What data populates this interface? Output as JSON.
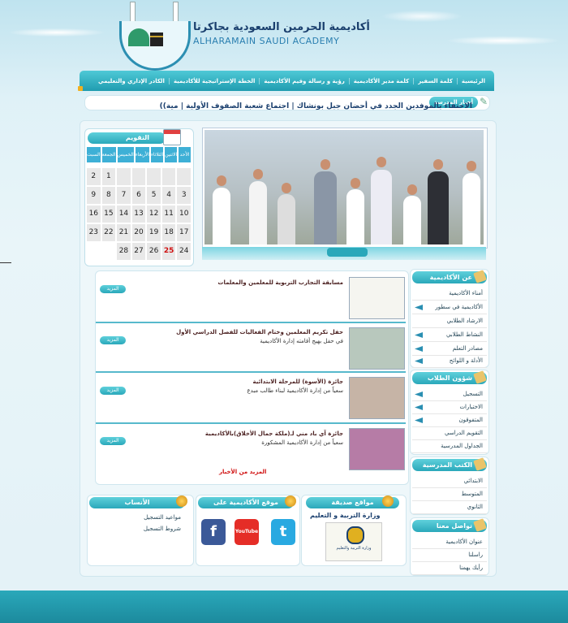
{
  "header": {
    "title_ar": "أكاديمية الحرمين السعودية بجاكرتا",
    "title_en": "ALHARAMAIN SAUDI ACADEMY"
  },
  "nav": [
    "الرئيسية",
    "كلمة السفير",
    "كلمة مدير الأكاديمية",
    "رؤية و رسالة وقيم الأكاديمية",
    "الخطة الإستراتيجية للأكاديمية",
    "الكادر الإداري والتعليمي"
  ],
  "ticker": {
    "label": "أخبار المدرسة",
    "text": "الاحتفاء بالموفدين الجدد في أحضان جبل بونشاك | اجتماع شعبة الصفوف الأولية | مية))"
  },
  "calendar": {
    "title": "التقويم",
    "days": [
      "الأحد",
      "الاثنين",
      "الثلاثاء",
      "الأربعاء",
      "الخميس",
      "الجمعة",
      "السبت"
    ],
    "dates": [
      "",
      "",
      "",
      "",
      "",
      "1",
      "2",
      "3",
      "4",
      "5",
      "6",
      "7",
      "8",
      "9",
      "10",
      "11",
      "12",
      "13",
      "14",
      "15",
      "16",
      "17",
      "18",
      "19",
      "20",
      "21",
      "22",
      "23",
      "24",
      "25",
      "26",
      "27",
      "28"
    ],
    "highlight": "25",
    "highlight_color": "#d01010"
  },
  "news": {
    "more_label": "المزيد",
    "all_news": "المزيد من الأخبار",
    "items": [
      {
        "title": "مسابقة التجارب التربوية للمعلمين والمعلمات",
        "sub": ""
      },
      {
        "title": "حفل تكريم المعلمين وختام الفعاليات للفصل الدراسي الأول",
        "sub": "في حفل بهيج أقامته إدارة الأكاديمية"
      },
      {
        "title": "جائزة (الأسوة) للمرحلة الابتدائية",
        "sub": "سعياً من إدارة الأكاديمية لبناء طالب مبدع"
      },
      {
        "title": "جائزة آي باد مني لـ(ملكة جمال الأخلاق)بالأكاديمية",
        "sub": "سعياً من إدارة الأكاديمية المشكورة"
      }
    ]
  },
  "sidebar": {
    "about": {
      "title": "عن الأكاديمية",
      "items": [
        "أمناء الأكاديمية",
        "الأكاديمية في سطور",
        "الارشاد الطلابي",
        "النشاط الطلابي",
        "مصادر التعلم",
        "الأدلة و اللوائح"
      ]
    },
    "students": {
      "title": "شؤون الطلاب",
      "items": [
        "التسجيل",
        "الاختبارات",
        "المتفوقون",
        "التقويم الدراسي",
        "الجداول المدرسية"
      ]
    },
    "books": {
      "title": "الكتب المدرسية",
      "items": [
        "الابتدائي",
        "المتوسط",
        "الثانوي"
      ]
    },
    "contact": {
      "title": "تواصل معنا",
      "items": [
        "عنوان الأكاديمية",
        "راسلنا",
        "رأيك يهمنا"
      ]
    }
  },
  "bottom": {
    "admission": {
      "title": "الأنساب",
      "links": [
        "مواعيد التسجيل",
        "شروط التسجيل"
      ]
    },
    "social": {
      "title": "موقع الأكاديمية على",
      "items": [
        "f",
        "YouTube",
        "t"
      ]
    },
    "friends": {
      "title": "مواقع صديقة",
      "link": "وزارة التربية و التعليم",
      "logo_caption": "وزارة التربية والتعليم"
    }
  },
  "colors": {
    "accent": "#2aa8ba",
    "title": "#1a3f6e",
    "red": "#d01010"
  }
}
